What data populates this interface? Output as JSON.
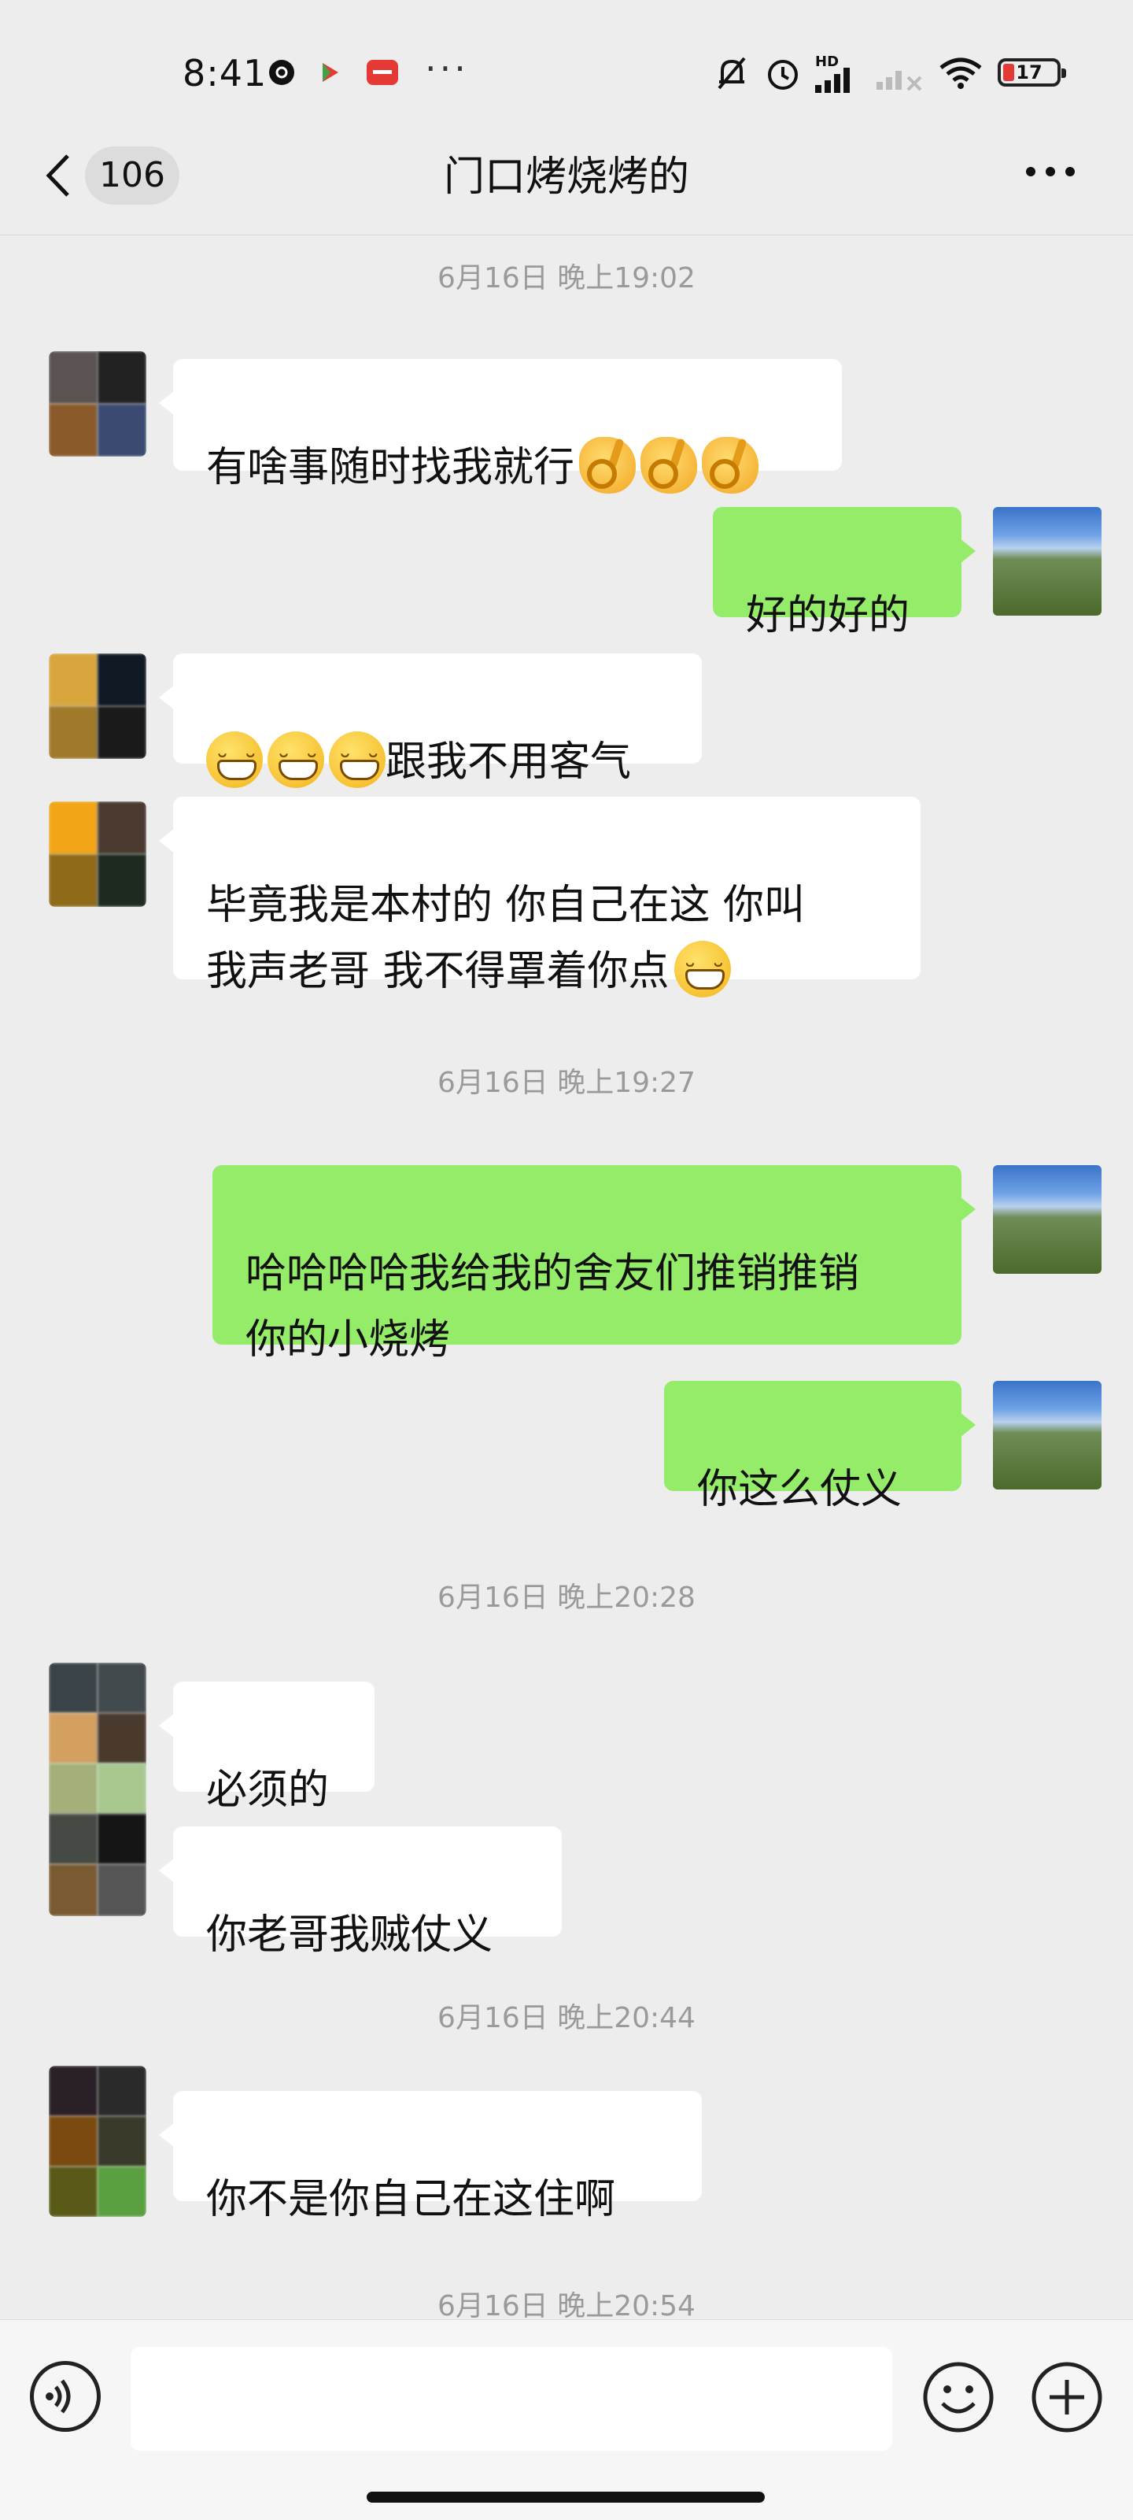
{
  "status_bar": {
    "time": "8:41",
    "dots": "···",
    "battery": "17",
    "network": "HD"
  },
  "header": {
    "back_count": "106",
    "title": "门口烤烧烤的",
    "more": "···"
  },
  "messages": {
    "ts1": "6月16日 晚上19:02",
    "m1": "有啥事随时找我就行",
    "m2": "好的好的",
    "m3": "跟我不用客气",
    "m4_line1": "毕竟我是本村的 你自己在这 你叫",
    "m4_line2": "我声老哥  我不得罩着你点",
    "ts2": "6月16日 晚上19:27",
    "m5_line1": "哈哈哈哈我给我的舍友们推销推销",
    "m5_line2": "你的小烧烤",
    "m6": "你这么仗义",
    "ts3": "6月16日 晚上20:28",
    "m7": "必须的",
    "m8": "你老哥我贼仗义",
    "ts4": "6月16日 晚上20:44",
    "m9": "你不是你自己在这住啊",
    "ts5": "6月16日 晚上20:54"
  },
  "input": {
    "value": "",
    "placeholder": ""
  },
  "colors": {
    "background": "#ededed",
    "bubble_self": "#95ec69",
    "bubble_other": "#ffffff",
    "timestamp": "#9a9a9a"
  },
  "icons": [
    "settings-icon",
    "app-icon",
    "mute-icon",
    "alarm-icon",
    "signal-icon",
    "wifi-icon",
    "battery-icon",
    "back-icon",
    "more-icon",
    "voice-icon",
    "emoji-icon",
    "plus-icon"
  ]
}
